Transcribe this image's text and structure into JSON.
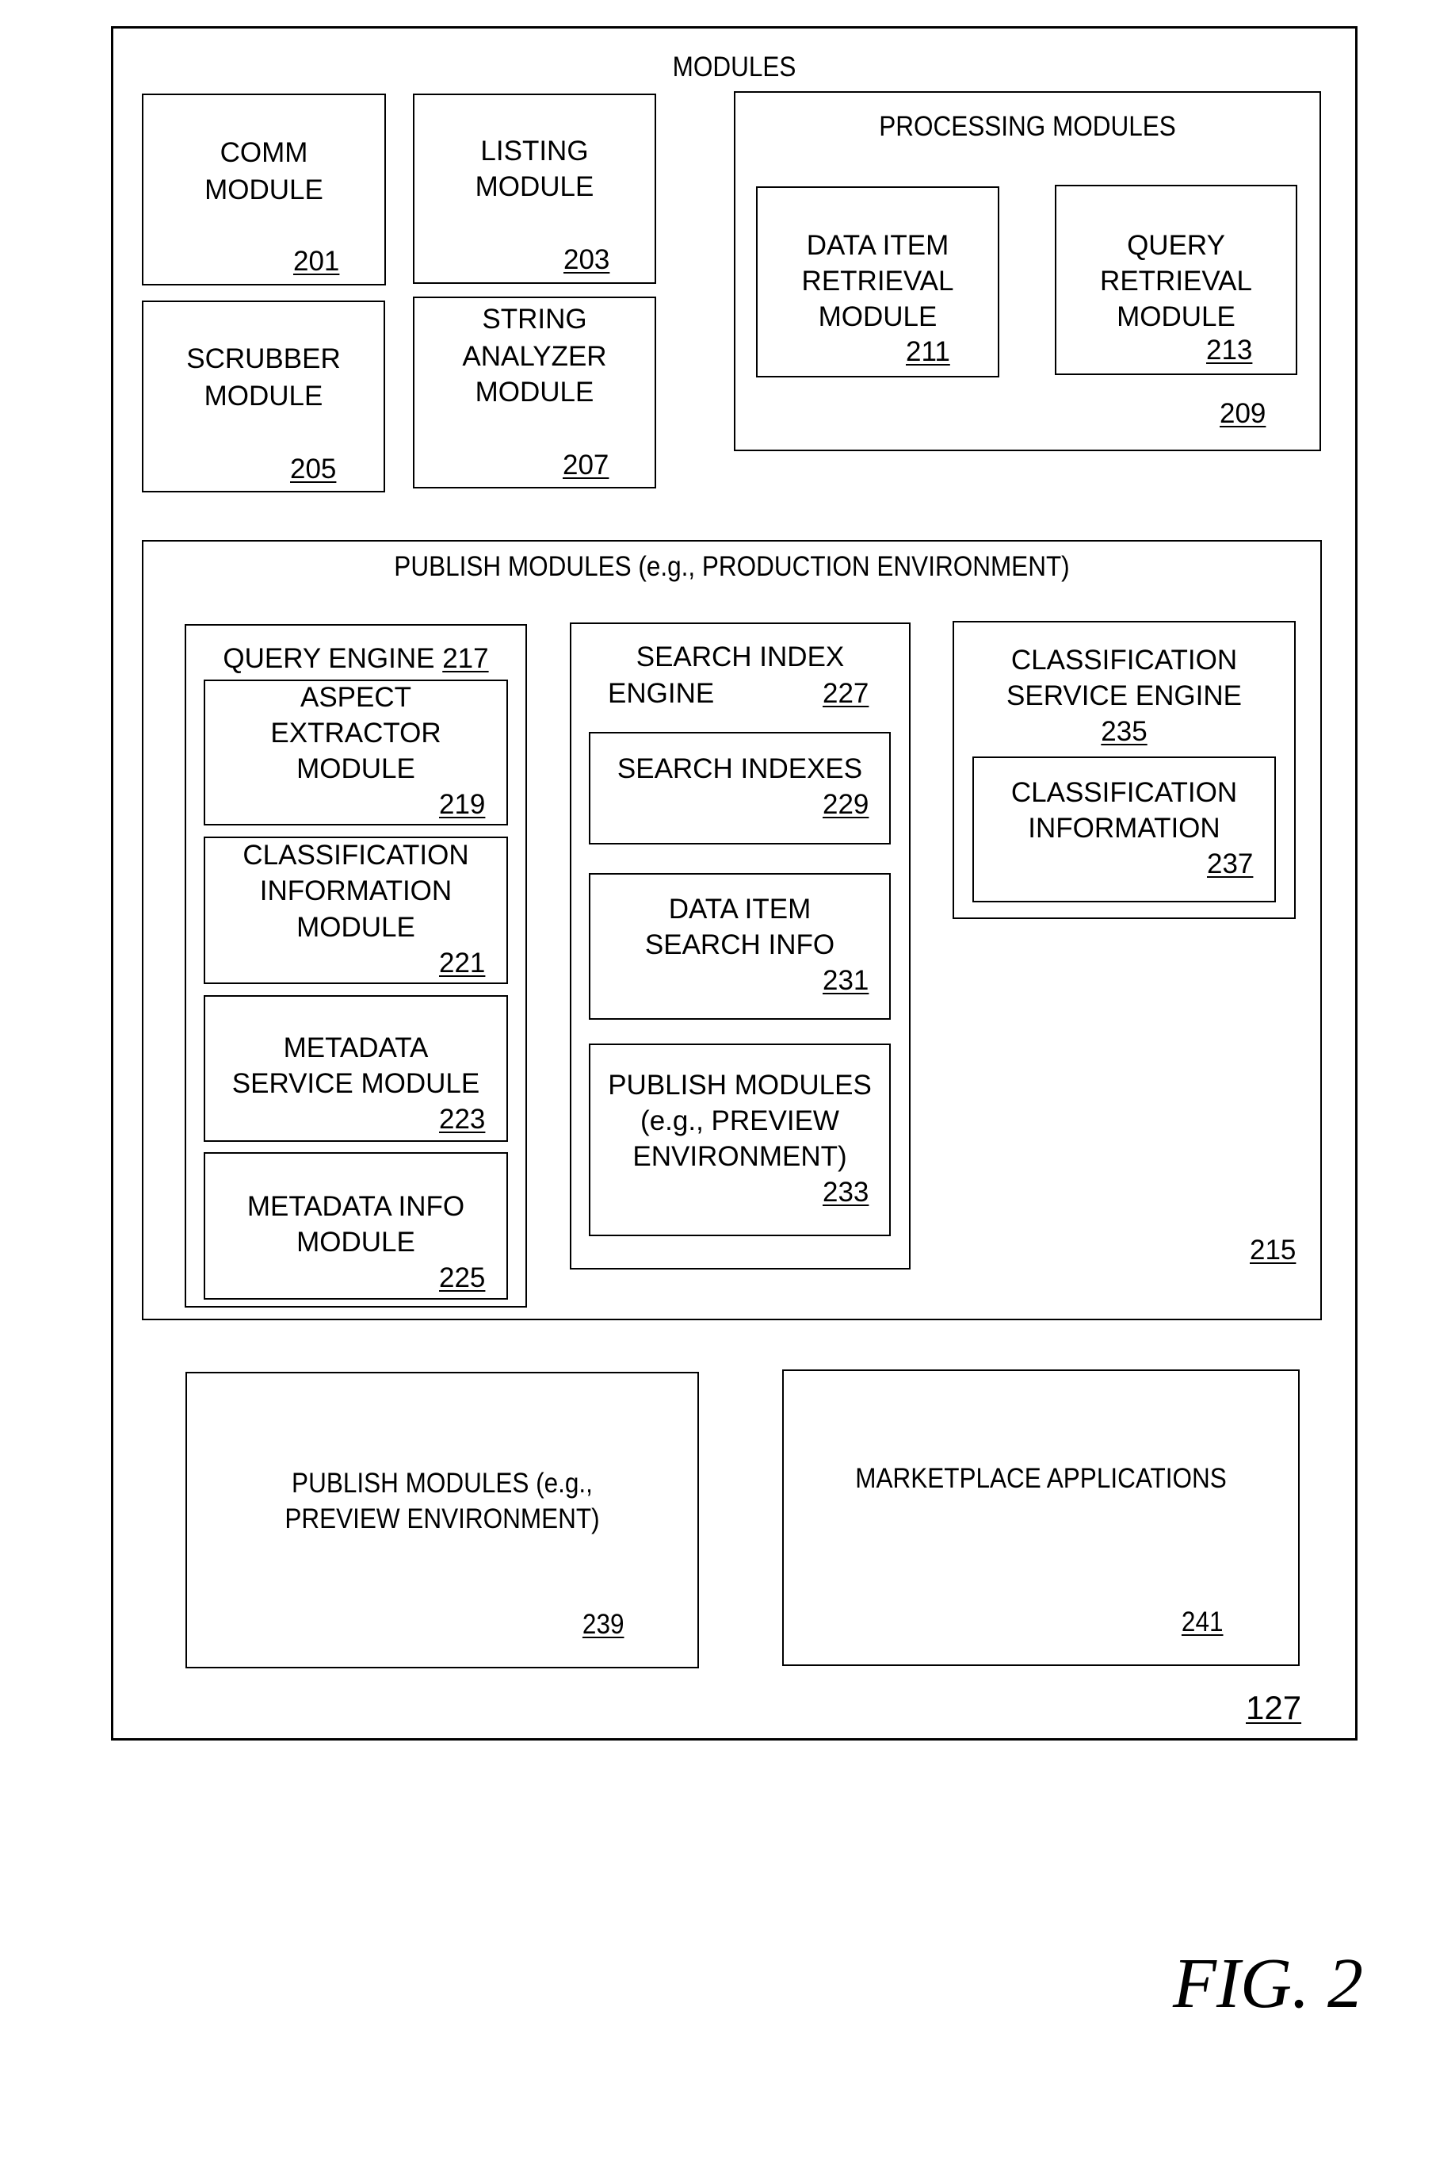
{
  "figure": {
    "label": "FIG. 2",
    "reference_number": "127",
    "title": "MODULES"
  },
  "modules": {
    "comm": {
      "lines": [
        "COMM",
        "MODULE"
      ],
      "ref": "201"
    },
    "listing": {
      "lines": [
        "LISTING",
        "MODULE"
      ],
      "ref": "203"
    },
    "scrubber": {
      "lines": [
        "SCRUBBER",
        "MODULE"
      ],
      "ref": "205"
    },
    "string_analyzer": {
      "lines": [
        "STRING",
        "ANALYZER",
        "MODULE"
      ],
      "ref": "207"
    },
    "processing": {
      "title": "PROCESSING MODULES",
      "ref": "209",
      "data_item_retrieval": {
        "lines": [
          "DATA ITEM",
          "RETRIEVAL",
          "MODULE"
        ],
        "ref": "211"
      },
      "query_retrieval": {
        "lines": [
          "QUERY",
          "RETRIEVAL",
          "MODULE"
        ],
        "ref": "213"
      }
    },
    "publish_production": {
      "title": "PUBLISH MODULES (e.g., PRODUCTION ENVIRONMENT)",
      "ref": "215",
      "query_engine": {
        "title": "QUERY ENGINE",
        "ref": "217",
        "aspect_extractor": {
          "lines": [
            "ASPECT",
            "EXTRACTOR",
            "MODULE"
          ],
          "ref": "219"
        },
        "classification_information": {
          "lines": [
            "CLASSIFICATION",
            "INFORMATION",
            "MODULE"
          ],
          "ref": "221"
        },
        "metadata_service": {
          "lines": [
            "METADATA",
            "SERVICE MODULE"
          ],
          "ref": "223"
        },
        "metadata_info": {
          "lines": [
            "METADATA INFO",
            "MODULE"
          ],
          "ref": "225"
        }
      },
      "search_index_engine": {
        "title_line1": "SEARCH INDEX",
        "title_line2": "ENGINE",
        "ref": "227",
        "search_indexes": {
          "lines": [
            "SEARCH INDEXES"
          ],
          "ref": "229"
        },
        "data_item_search_info": {
          "lines": [
            "DATA ITEM",
            "SEARCH INFO"
          ],
          "ref": "231"
        },
        "publish_preview": {
          "lines": [
            "PUBLISH MODULES",
            "(e.g., PREVIEW",
            "ENVIRONMENT)"
          ],
          "ref": "233"
        }
      },
      "classification_service_engine": {
        "lines": [
          "CLASSIFICATION",
          "SERVICE ENGINE"
        ],
        "ref": "235",
        "classification_information": {
          "lines": [
            "CLASSIFICATION",
            "INFORMATION"
          ],
          "ref": "237"
        }
      }
    },
    "publish_preview": {
      "lines": [
        "PUBLISH MODULES (e.g.,",
        "PREVIEW ENVIRONMENT)"
      ],
      "ref": "239"
    },
    "marketplace_applications": {
      "lines": [
        "MARKETPLACE APPLICATIONS"
      ],
      "ref": "241"
    }
  }
}
